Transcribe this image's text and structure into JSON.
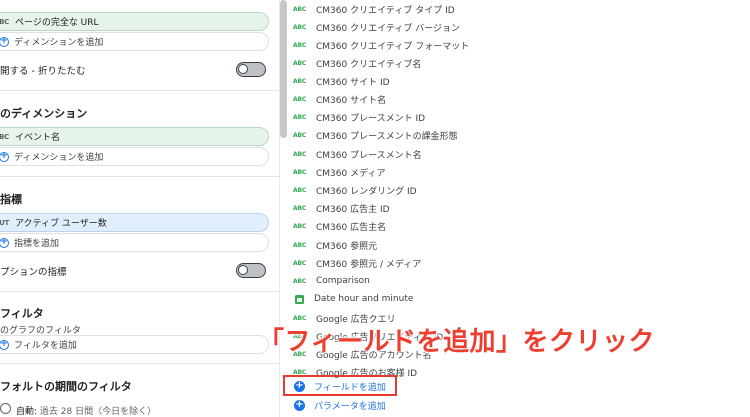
{
  "left_panel": {
    "top_chip": {
      "type": "ABC",
      "label": "ページの完全な URL"
    },
    "add_dimension_1": "ディメンションを追加",
    "collapse_toggle_label": "開する - 折りたたむ",
    "section_secondary_dimension": "のディメンション",
    "event_chip": {
      "type": "ABC",
      "label": "イベント名"
    },
    "add_dimension_2": "ディメンションを追加",
    "section_metric": "指標",
    "metric_chip": {
      "type": "AUT",
      "label": "アクティブ ユーザー数"
    },
    "add_metric": "指標を追加",
    "optional_metric_label": "プションの指標",
    "section_filter": "フィルタ",
    "chart_filter_label": "のグラフのフィルタ",
    "add_filter": "フィルタを追加",
    "section_default_date_filter": "フォルトの期間のフィルタ",
    "auto_label": "自動:",
    "auto_value": "過去 28 日間（今日を除く）"
  },
  "field_list": {
    "items": [
      {
        "icon": "abc",
        "name": "CM360 クリエイティブ タイプ ID"
      },
      {
        "icon": "abc",
        "name": "CM360 クリエイティブ バージョン"
      },
      {
        "icon": "abc",
        "name": "CM360 クリエイティブ フォーマット"
      },
      {
        "icon": "abc",
        "name": "CM360 クリエイティブ名"
      },
      {
        "icon": "abc",
        "name": "CM360 サイト ID"
      },
      {
        "icon": "abc",
        "name": "CM360 サイト名"
      },
      {
        "icon": "abc",
        "name": "CM360 プレースメント ID"
      },
      {
        "icon": "abc",
        "name": "CM360 プレースメントの課金形態"
      },
      {
        "icon": "abc",
        "name": "CM360 プレースメント名"
      },
      {
        "icon": "abc",
        "name": "CM360 メディア"
      },
      {
        "icon": "abc",
        "name": "CM360 レンダリング ID"
      },
      {
        "icon": "abc",
        "name": "CM360 広告主 ID"
      },
      {
        "icon": "abc",
        "name": "CM360 広告主名"
      },
      {
        "icon": "abc",
        "name": "CM360 参照元"
      },
      {
        "icon": "abc",
        "name": "CM360 参照元 / メディア"
      },
      {
        "icon": "abc",
        "name": "Comparison"
      },
      {
        "icon": "calendar",
        "name": "Date hour and minute"
      },
      {
        "icon": "abc",
        "name": "Google 広告クエリ"
      },
      {
        "icon": "abc",
        "name": "Google 広告クリエイティブ ID"
      },
      {
        "icon": "abc",
        "name": "Google 広告のアカウント名"
      },
      {
        "icon": "abc",
        "name": "Google 広告のお客様 ID"
      }
    ],
    "icon_text_abc": "ABC",
    "add_field": "フィールドを追加",
    "add_parameter": "パラメータを追加"
  },
  "annotation": "「フィールドを追加」をクリック",
  "colors": {
    "accent_blue": "#1a73e8",
    "dimension_green": "#34a853",
    "annotation_red": "#ec3f30"
  }
}
